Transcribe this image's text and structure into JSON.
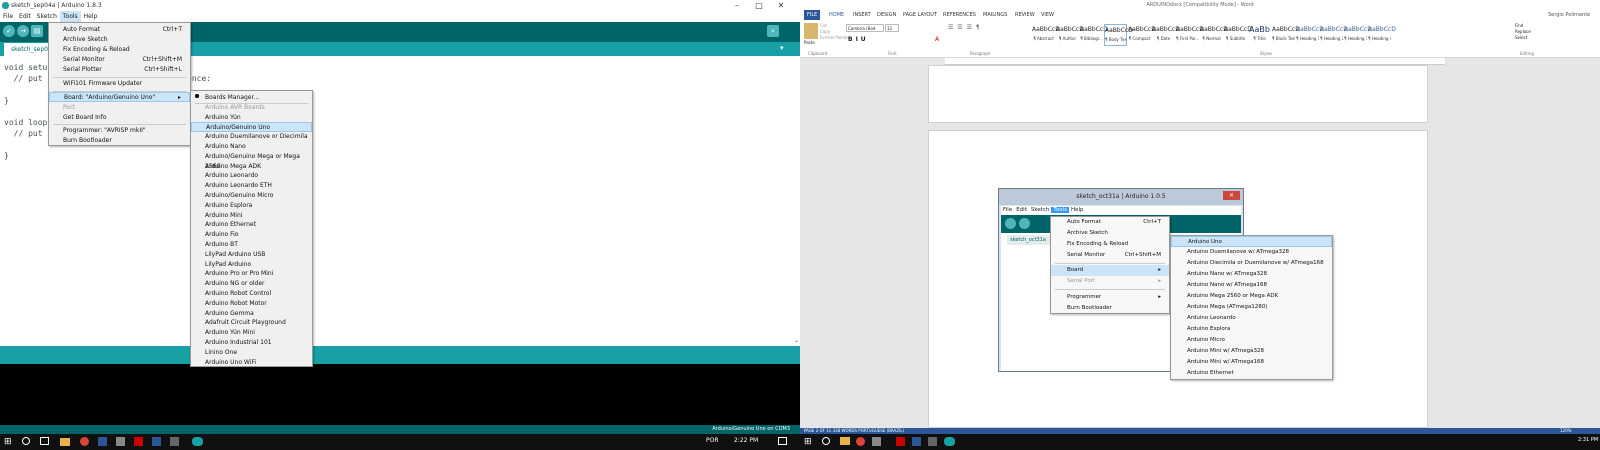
{
  "left": {
    "title": "sketch_sep04a | Arduino 1.8.3",
    "menu": [
      "File",
      "Edit",
      "Sketch",
      "Tools",
      "Help"
    ],
    "tab": "sketch_sep04a",
    "code": "void setup() {\n  // put your setup code here, to run once:\n\n}\n\nvoid loop() {\n  // put\n\n}",
    "footer": "Arduino/Genuino Uno on COM3",
    "tools_menu": [
      {
        "label": "Auto Format",
        "shortcut": "Ctrl+T"
      },
      {
        "label": "Archive Sketch",
        "shortcut": ""
      },
      {
        "label": "Fix Encoding & Reload",
        "shortcut": ""
      },
      {
        "label": "Serial Monitor",
        "shortcut": "Ctrl+Shift+M"
      },
      {
        "label": "Serial Plotter",
        "shortcut": "Ctrl+Shift+L"
      },
      {
        "label": "WiFi101 Firmware Updater",
        "shortcut": ""
      },
      {
        "label": "Board: \"Arduino/Genuino Uno\"",
        "shortcut": ""
      },
      {
        "label": "Port",
        "shortcut": ""
      },
      {
        "label": "Get Board Info",
        "shortcut": ""
      },
      {
        "label": "Programmer: \"AVRISP mkII\"",
        "shortcut": ""
      },
      {
        "label": "Burn Bootloader",
        "shortcut": ""
      }
    ],
    "boards_menu": [
      "Boards Manager...",
      "Arduino AVR Boards",
      "Arduino Yún",
      "Arduino/Genuino Uno",
      "Arduino Duemilanove or Diecimila",
      "Arduino Nano",
      "Arduino/Genuino Mega or Mega 2560",
      "Arduino Mega ADK",
      "Arduino Leonardo",
      "Arduino Leonardo ETH",
      "Arduino/Genuino Micro",
      "Arduino Esplora",
      "Arduino Mini",
      "Arduino Ethernet",
      "Arduino Fio",
      "Arduino BT",
      "LilyPad Arduino USB",
      "LilyPad Arduino",
      "Arduino Pro or Pro Mini",
      "Arduino NG or older",
      "Arduino Robot Control",
      "Arduino Robot Motor",
      "Arduino Gemma",
      "Adafruit Circuit Playground",
      "Arduino Yún Mini",
      "Arduino Industrial 101",
      "Linino One",
      "Arduino Uno WiFi"
    ]
  },
  "taskbar_left": {
    "lang": "POR",
    "time": "2:22 PM"
  },
  "word": {
    "title": "ARDUINOdocx [Compatibility Mode] - Word",
    "user": "Sergio Polimante",
    "tabs": [
      "FILE",
      "HOME",
      "INSERT",
      "DESIGN",
      "PAGE LAYOUT",
      "REFERENCES",
      "MAILINGS",
      "REVIEW",
      "VIEW"
    ],
    "font_name": "Cambria (Bod",
    "font_size": "12",
    "styles": [
      "¶ Abstract",
      "¶ Author",
      "¶ Bibliogr...",
      "¶ Body Text",
      "¶ Compact",
      "¶ Date",
      "¶ First Par...",
      "¶ Normal",
      "¶ Subtitle",
      "¶ Title",
      "¶ Block Text",
      "¶ Heading 1",
      "¶ Heading 2",
      "¶ Heading 3",
      "¶ Heading 4"
    ],
    "style_preview": "AaBbCcD",
    "style_preview_title": "AaBb",
    "groups": [
      "Clipboard",
      "Font",
      "Paragraph",
      "Styles",
      "Editing"
    ],
    "editing": [
      "Find",
      "Replace",
      "Select"
    ],
    "paste": "Paste",
    "clipboard_items": [
      "Cut",
      "Copy",
      "Format Painter"
    ],
    "status": "PAGE 2 OF 11    338 WORDS    PORTUGUESE (BRAZIL)",
    "zoom": "120%",
    "time": "2:31 PM"
  },
  "old_arduino": {
    "title": "sketch_oct31a | Arduino 1.0.5",
    "menu": [
      "File",
      "Edit",
      "Sketch",
      "Tools",
      "Help"
    ],
    "tab": "sketch_oct31a",
    "tools_menu": [
      {
        "label": "Auto Format",
        "shortcut": "Ctrl+T"
      },
      {
        "label": "Archive Sketch",
        "shortcut": ""
      },
      {
        "label": "Fix Encoding & Reload",
        "shortcut": ""
      },
      {
        "label": "Serial Monitor",
        "shortcut": "Ctrl+Shift+M"
      },
      {
        "label": "Board",
        "shortcut": ""
      },
      {
        "label": "Serial Port",
        "shortcut": ""
      },
      {
        "label": "Programmer",
        "shortcut": ""
      },
      {
        "label": "Burn Bootloader",
        "shortcut": ""
      }
    ],
    "boards_menu": [
      "Arduino Uno",
      "Arduino Duemilanove w/ ATmega328",
      "Arduino Diecimila or Duemilanove w/ ATmega168",
      "Arduino Nano w/ ATmega328",
      "Arduino Nano w/ ATmega168",
      "Arduino Mega 2560 or Mega ADK",
      "Arduino Mega (ATmega1280)",
      "Arduino Leonardo",
      "Arduino Esplora",
      "Arduino Micro",
      "Arduino Mini w/ ATmega328",
      "Arduino Mini w/ ATmega168",
      "Arduino Ethernet"
    ]
  },
  "colors": {
    "arduino_teal": "#17a1a5",
    "arduino_dark": "#006468",
    "word_blue": "#2b579a"
  }
}
